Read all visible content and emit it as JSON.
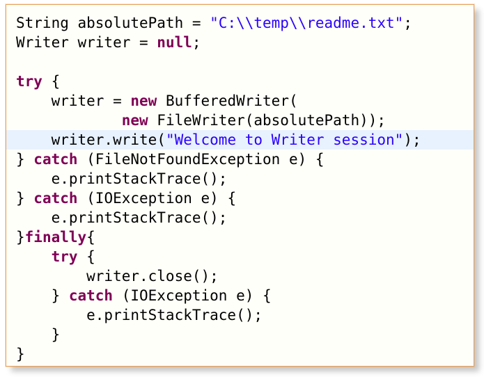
{
  "code": {
    "lines": [
      [
        {
          "t": "String absolutePath = "
        },
        {
          "t": "\"C:\\\\temp\\\\readme.txt\"",
          "c": "str"
        },
        {
          "t": ";"
        }
      ],
      [
        {
          "t": "Writer writer = "
        },
        {
          "t": "null",
          "c": "kw"
        },
        {
          "t": ";"
        }
      ],
      [
        {
          "t": ""
        }
      ],
      [
        {
          "t": "try",
          "c": "kw"
        },
        {
          "t": " {"
        }
      ],
      [
        {
          "t": "    writer = "
        },
        {
          "t": "new",
          "c": "kw"
        },
        {
          "t": " BufferedWriter("
        }
      ],
      [
        {
          "t": "            "
        },
        {
          "t": "new",
          "c": "kw"
        },
        {
          "t": " FileWriter(absolutePath));"
        }
      ],
      [
        {
          "t": "    writer.write("
        },
        {
          "t": "\"Welcome to Writer session\"",
          "c": "str"
        },
        {
          "t": ");"
        }
      ],
      [
        {
          "t": "} "
        },
        {
          "t": "catch",
          "c": "kw"
        },
        {
          "t": " (FileNotFoundException e) {"
        }
      ],
      [
        {
          "t": "    e.printStackTrace();"
        }
      ],
      [
        {
          "t": "} "
        },
        {
          "t": "catch",
          "c": "kw"
        },
        {
          "t": " (IOException e) {"
        }
      ],
      [
        {
          "t": "    e.printStackTrace();"
        }
      ],
      [
        {
          "t": "}"
        },
        {
          "t": "finally",
          "c": "kw"
        },
        {
          "t": "{"
        }
      ],
      [
        {
          "t": "    "
        },
        {
          "t": "try",
          "c": "kw"
        },
        {
          "t": " {"
        }
      ],
      [
        {
          "t": "        writer.close();"
        }
      ],
      [
        {
          "t": "    } "
        },
        {
          "t": "catch",
          "c": "kw"
        },
        {
          "t": " (IOException e) {"
        }
      ],
      [
        {
          "t": "        e.printStackTrace();"
        }
      ],
      [
        {
          "t": "    }"
        }
      ],
      [
        {
          "t": "}"
        }
      ]
    ],
    "highlighted_line": 6
  },
  "colors": {
    "keyword": "#7f0055",
    "string": "#2a00ff",
    "highlight": "#e8f2fe",
    "border": "#e8a05a"
  }
}
